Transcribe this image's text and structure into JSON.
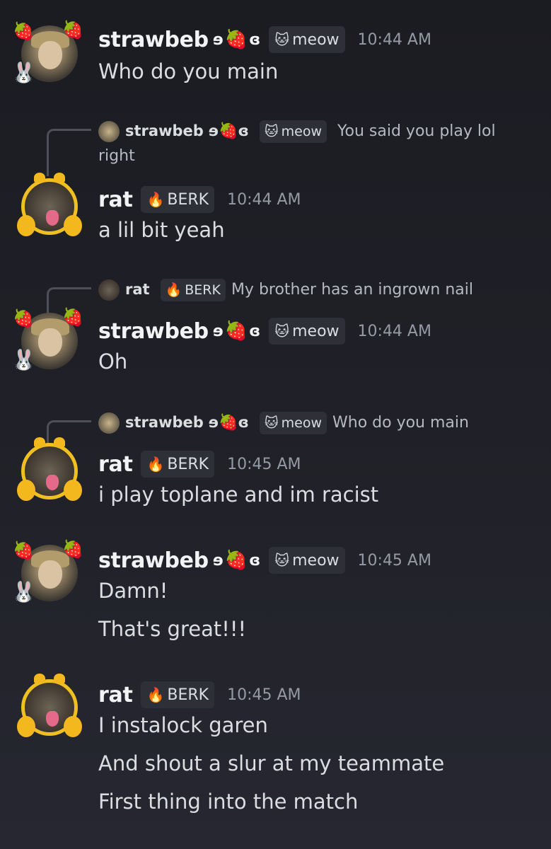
{
  "users": {
    "strawbeb": {
      "name": "strawbeb",
      "glyph_left": "ɘ",
      "glyph_right": "ɞ",
      "emoji": "🍓",
      "tag_icon": "🐱",
      "tag": "meow"
    },
    "rat": {
      "name": "rat",
      "tag_icon": "🔥",
      "tag": "BERK"
    }
  },
  "messages": [
    {
      "time": "10:44 AM",
      "lines": [
        "Who do you main"
      ]
    },
    {
      "reply": {
        "text": "You said you play lol",
        "text2": "right"
      },
      "time": "10:44 AM",
      "lines": [
        "a lil bit yeah"
      ]
    },
    {
      "reply": {
        "text": "My brother has an ingrown nail"
      },
      "time": "10:44 AM",
      "lines": [
        "Oh"
      ]
    },
    {
      "reply": {
        "text": "Who do you main"
      },
      "time": "10:45 AM",
      "lines": [
        "i play toplane and im racist"
      ]
    },
    {
      "time": "10:45 AM",
      "lines": [
        "Damn!",
        "That's great!!!"
      ]
    },
    {
      "time": "10:45 AM",
      "lines": [
        "I instalock garen",
        "And shout a slur at my teammate",
        "First thing into the match"
      ]
    }
  ],
  "colors": {
    "background": "#1e1f24",
    "username": "#f2f3f5",
    "text": "#dbdee1",
    "muted": "#949ba4",
    "tag_bg": "#2e3038"
  }
}
